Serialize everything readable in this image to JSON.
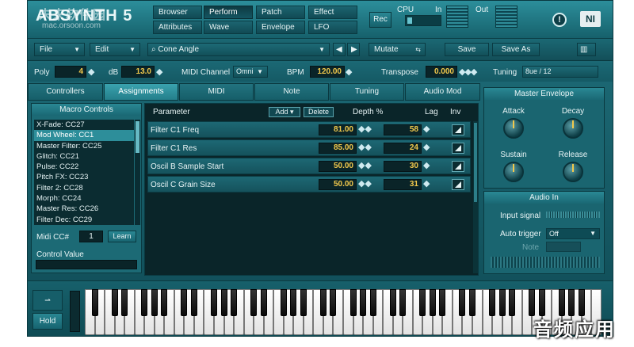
{
  "header": {
    "logo": "ABSYNTH 5",
    "watermark": "未来软件园",
    "watermark_url": "mac.orsoon.com",
    "nav": [
      "Browser",
      "Perform",
      "Patch",
      "Effect",
      "Attributes",
      "Wave",
      "Envelope",
      "LFO"
    ],
    "active_nav": "Perform",
    "rec_label": "Rec",
    "cpu_label": "CPU",
    "in_label": "In",
    "out_label": "Out",
    "info_icon": "!",
    "ni_logo": "NI"
  },
  "toolbar": {
    "file_label": "File",
    "edit_label": "Edit",
    "preset_name": "Cone Angle",
    "mutate_label": "Mutate",
    "save_label": "Save",
    "save_as_label": "Save As"
  },
  "parambar": {
    "poly_label": "Poly",
    "poly_value": "4",
    "db_label": "dB",
    "db_value": "13.0",
    "midi_channel_label": "MIDI Channel",
    "midi_channel_value": "Omni",
    "bpm_label": "BPM",
    "bpm_value": "120.00",
    "transpose_label": "Transpose",
    "transpose_value": "0.000",
    "tuning_label": "Tuning",
    "tuning_value": "8ue / 12"
  },
  "tabs": [
    "Controllers",
    "Assignments",
    "MIDI",
    "Note",
    "Tuning",
    "Audio Mod"
  ],
  "active_tab": "Assignments",
  "macro": {
    "title": "Macro Controls",
    "items": [
      "X-Fade: CC27",
      "Mod Wheel: CC1",
      "Master Filter: CC25",
      "Glitch: CC21",
      "Pulse: CC22",
      "Pitch FX: CC23",
      "Filter 2: CC28",
      "Morph: CC24",
      "Master Res: CC26",
      "Filter Dec: CC29"
    ],
    "selected_index": 1,
    "midi_cc_label": "Midi CC#",
    "midi_cc_value": "1",
    "learn_label": "Learn",
    "control_value_label": "Control Value"
  },
  "assign": {
    "col_parameter": "Parameter",
    "add_label": "Add",
    "delete_label": "Delete",
    "col_depth": "Depth %",
    "col_lag": "Lag",
    "col_inv": "Inv",
    "rows": [
      {
        "parameter": "Filter C1 Freq",
        "depth": "81.00",
        "lag": "58"
      },
      {
        "parameter": "Filter C1 Res",
        "depth": "85.00",
        "lag": "24"
      },
      {
        "parameter": "Oscil B Sample Start",
        "depth": "50.00",
        "lag": "30"
      },
      {
        "parameter": "Oscil C Grain Size",
        "depth": "50.00",
        "lag": "31"
      }
    ]
  },
  "envelope": {
    "title": "Master Envelope",
    "attack": "Attack",
    "decay": "Decay",
    "sustain": "Sustain",
    "release": "Release"
  },
  "audio_in": {
    "title": "Audio In",
    "input_signal": "Input signal",
    "auto_trigger": "Auto trigger",
    "auto_trigger_value": "Off",
    "note": "Note"
  },
  "keyboard": {
    "hold_label": "Hold"
  },
  "caption": "音频应用"
}
